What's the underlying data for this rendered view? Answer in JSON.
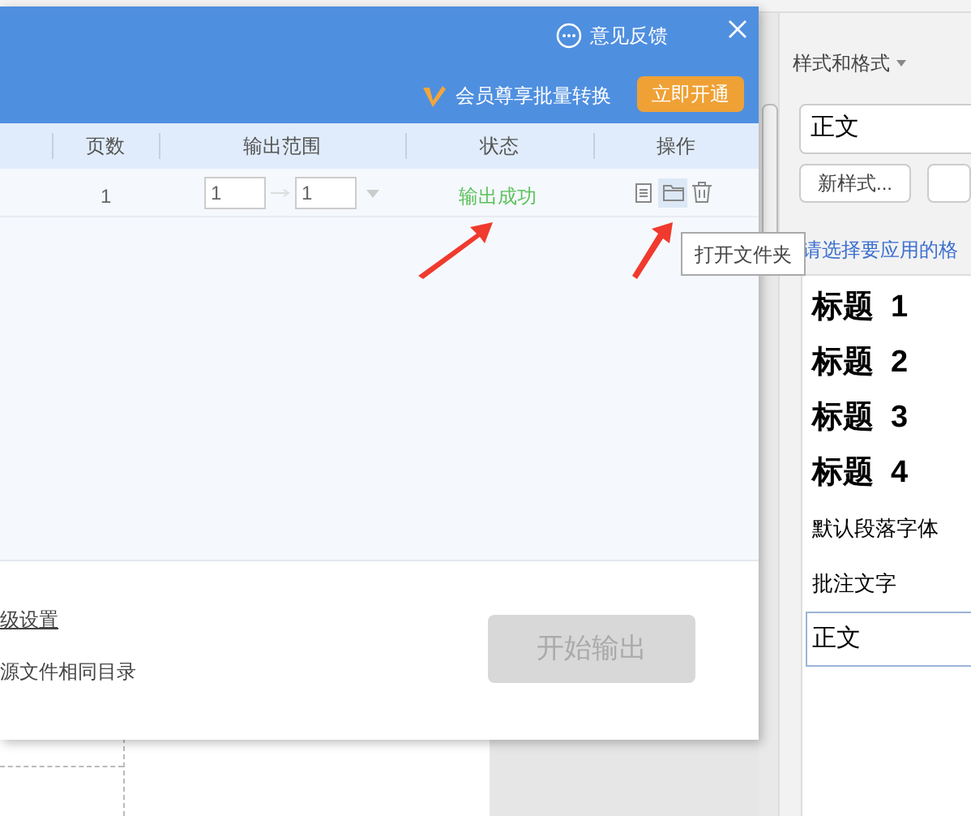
{
  "dialog": {
    "feedback": "意见反馈",
    "promo": "会员尊享批量转换",
    "upgrade_button": "立即开通",
    "columns": [
      "页数",
      "输出范围",
      "状态",
      "操作"
    ],
    "rows": [
      {
        "pages": "1",
        "range_from": "1",
        "range_to": "1",
        "status": "输出成功"
      }
    ],
    "tooltip": "打开文件夹",
    "advanced_link": "级设置",
    "output_dir": "源文件相同目录",
    "start_button": {
      "label": "开始输出",
      "disabled": true
    }
  },
  "styles_panel": {
    "title": "样式和格式",
    "current_style": "正文",
    "new_style_button": "新样式...",
    "hint": "请选择要应用的格",
    "styles": [
      {
        "label": "标题  1",
        "kind": "heading",
        "selected": false
      },
      {
        "label": "标题  2",
        "kind": "heading",
        "selected": false
      },
      {
        "label": "标题  3",
        "kind": "heading",
        "selected": false
      },
      {
        "label": "标题  4",
        "kind": "heading",
        "selected": false
      },
      {
        "label": "默认段落字体",
        "kind": "plain",
        "selected": false
      },
      {
        "label": "批注文字",
        "kind": "plain",
        "selected": false
      },
      {
        "label": "正文",
        "kind": "plain",
        "selected": true
      }
    ]
  }
}
